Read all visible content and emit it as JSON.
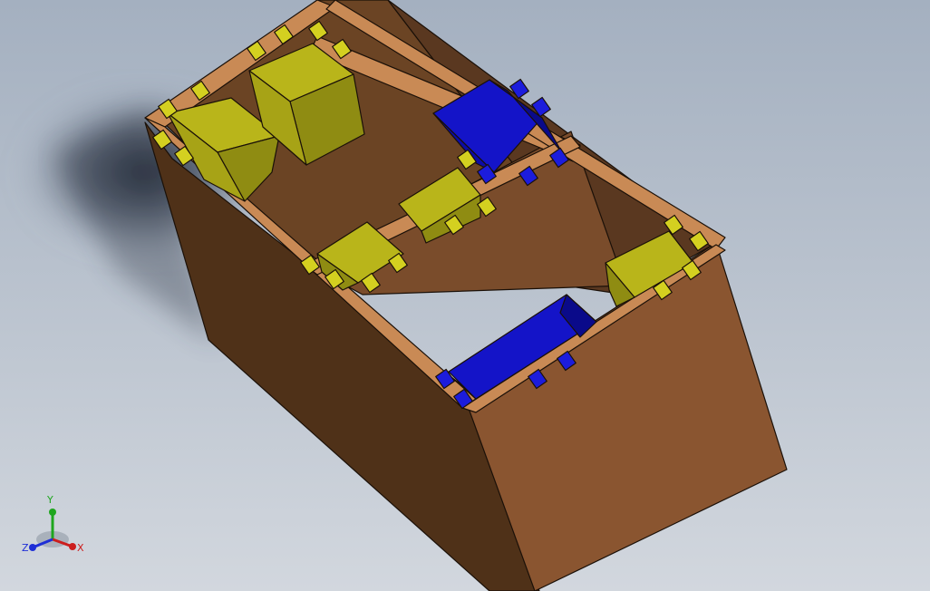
{
  "viewport": {
    "background_top": "#a4b0c0",
    "background_bottom": "#d2d7de"
  },
  "model": {
    "colors": {
      "wood_top": "#c98a55",
      "wood_front": "#8a5530",
      "wood_left": "#4f3118",
      "wood_inner": "#6b4424",
      "bin_yellow": "#b9b51a",
      "bin_yellow_dark": "#8f8c12",
      "bin_blue": "#1414c8",
      "bin_blue_dark": "#0a0a8a",
      "edge": "#1a1008"
    }
  },
  "triad": {
    "x_label": "X",
    "y_label": "Y",
    "z_label": "Z",
    "x_color": "#cc1e1e",
    "y_color": "#1ea61e",
    "z_color": "#1e2ed6"
  }
}
